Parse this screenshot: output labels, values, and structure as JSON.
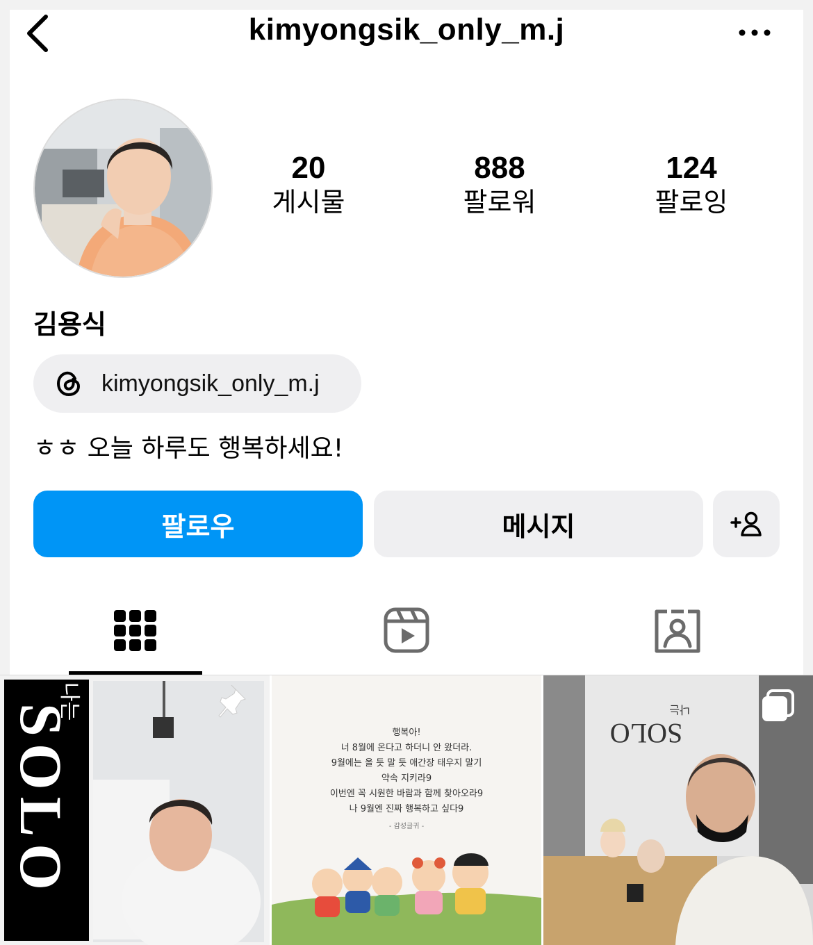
{
  "header": {
    "username": "kimyongsik_only_m.j",
    "back_icon": "chevron-left-icon",
    "more_icon": "more-horizontal-icon"
  },
  "profile": {
    "display_name": "김용식",
    "threads_handle": "kimyongsik_only_m.j",
    "bio": "ㅎㅎ 오늘 하루도 행복하세요!"
  },
  "stats": [
    {
      "value": "20",
      "label": "게시물"
    },
    {
      "value": "888",
      "label": "팔로워"
    },
    {
      "value": "124",
      "label": "팔로잉"
    }
  ],
  "actions": {
    "follow_label": "팔로우",
    "message_label": "메시지",
    "add_icon": "add-person-icon"
  },
  "colors": {
    "follow_blue": "#0095f6",
    "chip_gray": "#efeff1"
  },
  "tabs": [
    "grid-icon",
    "reels-icon",
    "tagged-icon"
  ],
  "posts": {
    "post2_pinned": "pin-icon",
    "post3_text": [
      "행복아!",
      "너 8월에 온다고 하더니 안 왔더라.",
      "9월에는 올 듯 말 듯 애간장 태우지 말기",
      "약속 지키라9",
      "이번엔 꼭 시원한 바람과 함께 찾아오라9",
      "나 9월엔 진짜 행복하고 싶다9",
      "- 감성글귀 -"
    ],
    "post1_logo": "나는 SOLO",
    "post4_sign": "나는 SOLO",
    "post4_multi": "carousel-icon"
  }
}
